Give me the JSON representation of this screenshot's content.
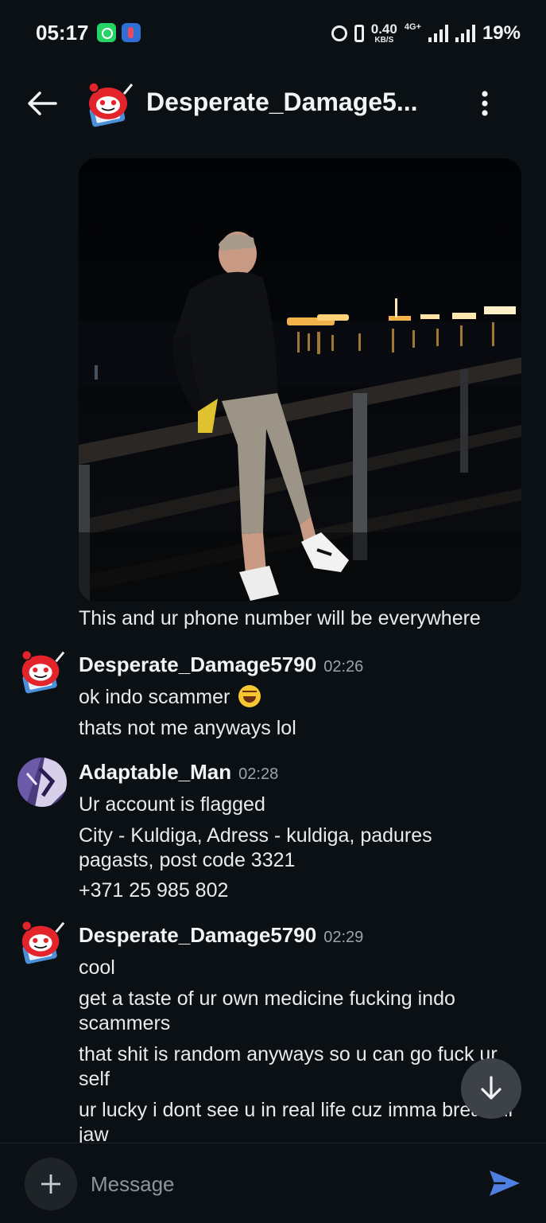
{
  "status_bar": {
    "time": "05:17",
    "net_speed_value": "0.40",
    "net_speed_unit": "KB/S",
    "network_type": "4G+",
    "battery_percent": "19%",
    "notification_icons": [
      "whatsapp-icon",
      "teams-icon"
    ]
  },
  "header": {
    "title": "Desperate_Damage5...",
    "back_icon": "arrow-left-icon",
    "menu_icon": "more-vertical-icon"
  },
  "image_message": {
    "caption": "This and ur phone number will be everywhere"
  },
  "messages": [
    {
      "username": "Desperate_Damage5790",
      "time": "02:26",
      "avatar": "snoo-avatar",
      "lines": [
        "ok indo scammer",
        "thats not me anyways lol"
      ],
      "emoji": "rolling-on-floor-laughing-emoji"
    },
    {
      "username": "Adaptable_Man",
      "time": "02:28",
      "avatar": "purple-abstract-avatar",
      "lines": [
        "Ur account is flagged",
        "City - Kuldiga, Adress - kuldiga, padures pagasts, post code 3321",
        "+371 25 985 802"
      ]
    },
    {
      "username": "Desperate_Damage5790",
      "time": "02:29",
      "avatar": "snoo-avatar",
      "lines": [
        "cool",
        "get a taste of ur own medicine fucking indo scammers",
        "that shit is random anyways so u can go fuck ur self",
        "ur lucky i dont see u in real life cuz imma break ur jaw"
      ]
    }
  ],
  "composer": {
    "placeholder": "Message",
    "value": ""
  },
  "colors": {
    "background": "#0b1014",
    "send_accent": "#4f7fe0",
    "timestamp": "#9aa4ad",
    "fab": "#3c4248"
  }
}
